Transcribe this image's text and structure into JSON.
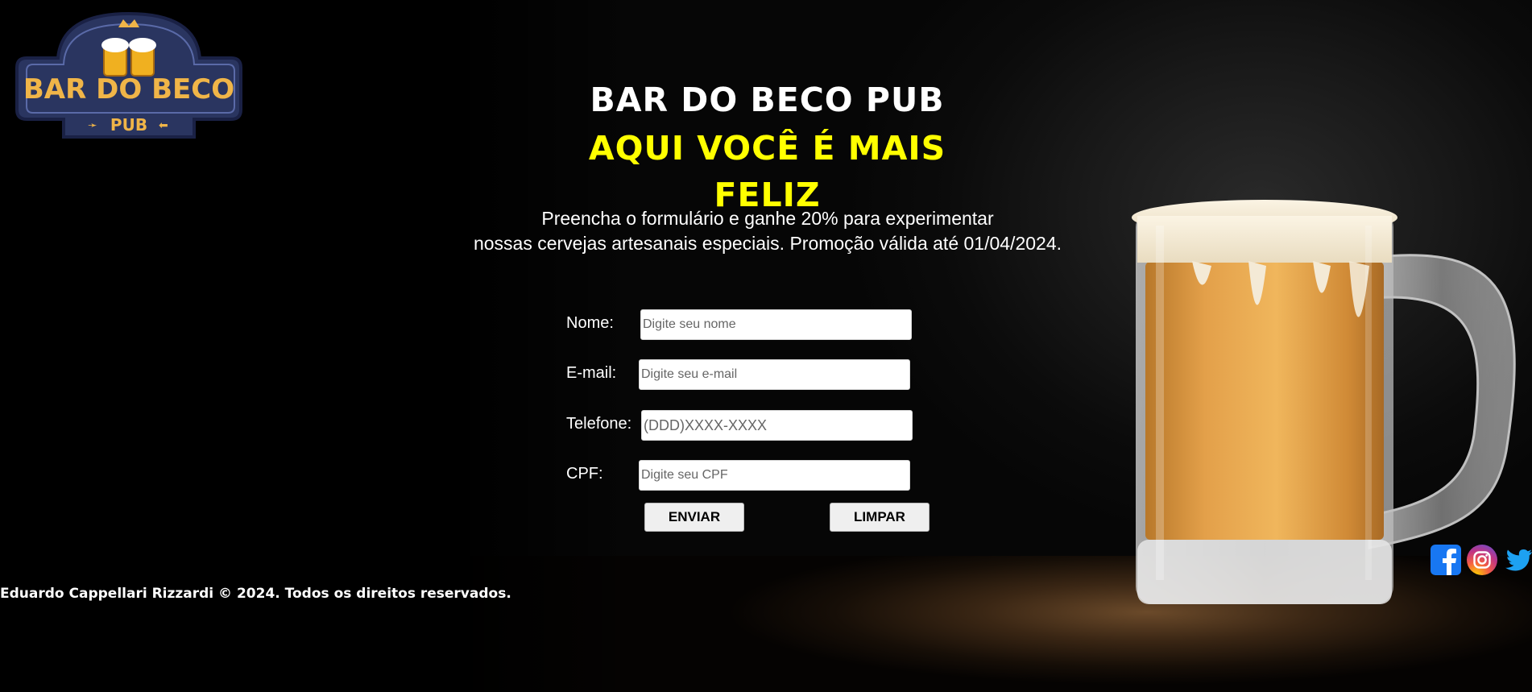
{
  "logo": {
    "name": "BAR DO BECO",
    "sub": "PUB"
  },
  "hero": {
    "title": "BAR DO BECO PUB",
    "tagline": "AQUI VOCÊ É MAIS FELIZ"
  },
  "promo": {
    "line1": "Preencha o formulário e ganhe 20% para experimentar",
    "line2": "nossas cervejas artesanais especiais. Promoção válida até 01/04/2024."
  },
  "form": {
    "name_label": "Nome:",
    "name_placeholder": "Digite seu nome",
    "email_label": "E-mail:",
    "email_placeholder": "Digite seu e-mail",
    "phone_label": "Telefone:",
    "phone_placeholder": "(DDD)XXXX-XXXX",
    "cpf_label": "CPF:",
    "cpf_placeholder": "Digite seu CPF",
    "submit_label": "ENVIAR",
    "reset_label": "LIMPAR"
  },
  "footer": {
    "copyright": "Eduardo Cappellari Rizzardi © 2024. Todos os direitos reservados."
  },
  "social": {
    "icons": [
      "facebook-icon",
      "instagram-icon",
      "twitter-icon"
    ]
  },
  "colors": {
    "background": "#000000",
    "tagline": "#ffff00",
    "logo_bg": "#2a3560",
    "logo_text": "#f0b548"
  }
}
